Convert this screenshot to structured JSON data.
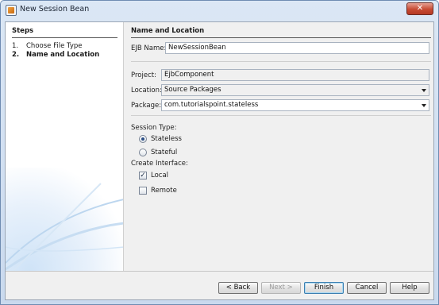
{
  "window": {
    "title": "New Session Bean",
    "close_glyph": "✕"
  },
  "steps": {
    "heading": "Steps",
    "items": [
      {
        "num": "1.",
        "label": "Choose File Type"
      },
      {
        "num": "2.",
        "label": "Name and Location"
      }
    ]
  },
  "panel": {
    "heading": "Name and Location",
    "ejb_name_label": "EJB Name:",
    "ejb_name_value": "NewSessionBean",
    "project_label": "Project:",
    "project_value": "EjbComponent",
    "location_label": "Location:",
    "location_value": "Source Packages",
    "package_label": "Package:",
    "package_value": "com.tutorialspoint.stateless",
    "session_type_label": "Session Type:",
    "session_options": [
      {
        "label": "Stateless",
        "checked": true
      },
      {
        "label": "Stateful",
        "checked": false
      }
    ],
    "create_interface_label": "Create Interface:",
    "interface_options": [
      {
        "label": "Local",
        "checked": true
      },
      {
        "label": "Remote",
        "checked": false
      }
    ]
  },
  "buttons": {
    "back": "< Back",
    "next": "Next >",
    "finish": "Finish",
    "cancel": "Cancel",
    "help": "Help"
  },
  "icons": {
    "window_icon": "bean-icon",
    "combo_arrow": "chevron-down-icon",
    "check_mark": "✓"
  }
}
